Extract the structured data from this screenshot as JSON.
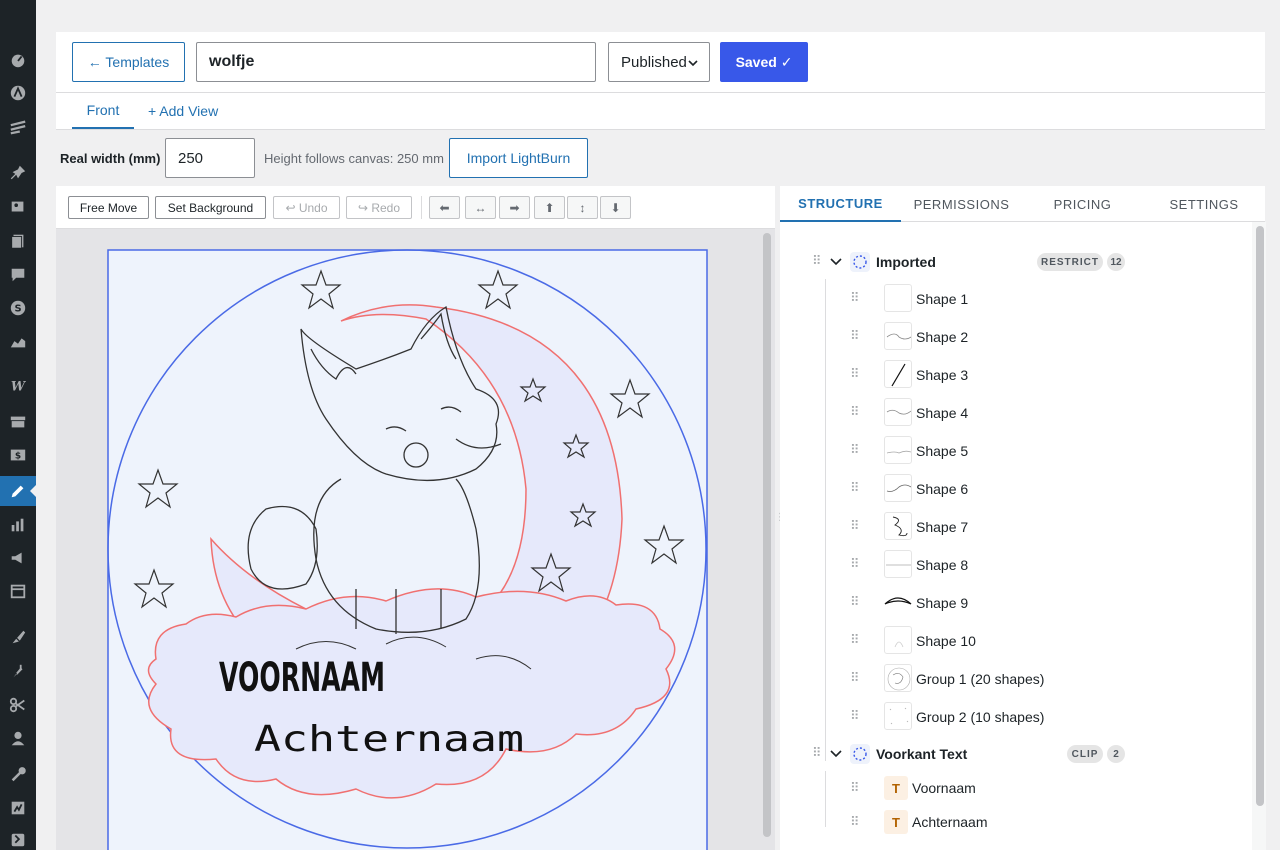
{
  "header": {
    "back_label": "← Templates",
    "title_value": "wolfje",
    "status": "Published",
    "save_label": "Saved ✓"
  },
  "views": {
    "tabs": [
      {
        "label": "Front"
      }
    ],
    "add_label": "+ Add View"
  },
  "dimensions": {
    "width_label": "Real width (mm)",
    "width_value": "250",
    "height_hint": "Height follows canvas: 250 mm",
    "import_label": "Import LightBurn"
  },
  "toolbar": {
    "free_move": "Free Move",
    "set_background": "Set Background",
    "undo": "↩ Undo",
    "redo": "↪ Redo",
    "align_icons": [
      "⬅",
      "↔",
      "➡",
      "⬆",
      "↕",
      "⬇"
    ]
  },
  "canvas": {
    "first_name": "VOORNAAM",
    "last_name": "Achternaam",
    "colors": {
      "bg": "#eef3fc",
      "moon_fill": "#e6e9fb",
      "red_outline": "#f07070",
      "blue_border": "#4a6ae6",
      "line": "#333333"
    }
  },
  "panel": {
    "tabs": [
      "STRUCTURE",
      "PERMISSIONS",
      "PRICING",
      "SETTINGS"
    ],
    "groups": [
      {
        "name": "Imported",
        "badge": "RESTRICT",
        "count": "12",
        "items": [
          "Shape 1",
          "Shape 2",
          "Shape 3",
          "Shape 4",
          "Shape 5",
          "Shape 6",
          "Shape 7",
          "Shape 8",
          "Shape 9",
          "Shape 10",
          "Group 1 (20 shapes)",
          "Group 2 (10 shapes)"
        ]
      },
      {
        "name": "Voorkant Text",
        "badge": "CLIP",
        "count": "2",
        "items": [
          "Voornaam",
          "Achternaam"
        ],
        "item_icon": "T"
      }
    ]
  },
  "theme": {
    "accent": "#2271b1",
    "primary": "#3858e9",
    "sidebar": "#1d2327"
  }
}
